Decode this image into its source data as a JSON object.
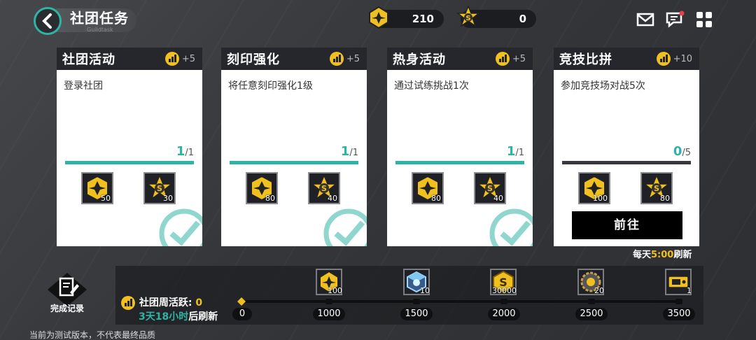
{
  "header": {
    "title": "社团任务",
    "subtitle": "Guildtask"
  },
  "resources": [
    {
      "icon": "badge-plane-icon",
      "value": "210"
    },
    {
      "icon": "badge-s-star-icon",
      "value": "0"
    }
  ],
  "top_icons": [
    "mail-icon",
    "chat-icon",
    "menu-grid-icon"
  ],
  "colors": {
    "accent": "#2fb3a6",
    "gold": "#f0c020",
    "dark": "#25272c"
  },
  "tasks": [
    {
      "title": "社团活动",
      "points": "+5",
      "desc": "登录社团",
      "progress_cur": "1",
      "progress_total": "/1",
      "progress_fraction": 1.0,
      "rewards": [
        "50",
        "30"
      ],
      "completed": true
    },
    {
      "title": "刻印强化",
      "points": "+5",
      "desc": "将任意刻印强化1级",
      "progress_cur": "1",
      "progress_total": "/1",
      "progress_fraction": 1.0,
      "rewards": [
        "80",
        "40"
      ],
      "completed": true
    },
    {
      "title": "热身活动",
      "points": "+5",
      "desc": "通过试练挑战1次",
      "progress_cur": "1",
      "progress_total": "/1",
      "progress_fraction": 1.0,
      "rewards": [
        "80",
        "40"
      ],
      "completed": true
    },
    {
      "title": "竞技比拼",
      "points": "+10",
      "desc": "参加竞技场对战5次",
      "progress_cur": "0",
      "progress_total": "/5",
      "progress_fraction": 0.0,
      "rewards": [
        "100",
        "80"
      ],
      "completed": false,
      "action": "前往"
    }
  ],
  "refresh": {
    "prefix": "每天",
    "time": "5:00",
    "suffix": "刷新"
  },
  "record": {
    "label": "完成记录"
  },
  "weekly": {
    "label": "社团周活跃:",
    "value": "0",
    "countdown": "3天18小时",
    "countdown_suffix": "后刷新"
  },
  "milestones": [
    {
      "threshold": "0"
    },
    {
      "threshold": "1000",
      "reward_icon": "badge-plane-icon",
      "count": "100"
    },
    {
      "threshold": "1500",
      "reward_icon": "crystal-cube-icon",
      "count": "10"
    },
    {
      "threshold": "2000",
      "reward_icon": "gold-coin-icon",
      "count": "30000"
    },
    {
      "threshold": "2500",
      "reward_icon": "gear-core-icon",
      "count": "20"
    },
    {
      "threshold": "3500",
      "reward_icon": "ticket-icon",
      "count": "1"
    }
  ],
  "footer": "当前为测试版本，不代表最终品质"
}
